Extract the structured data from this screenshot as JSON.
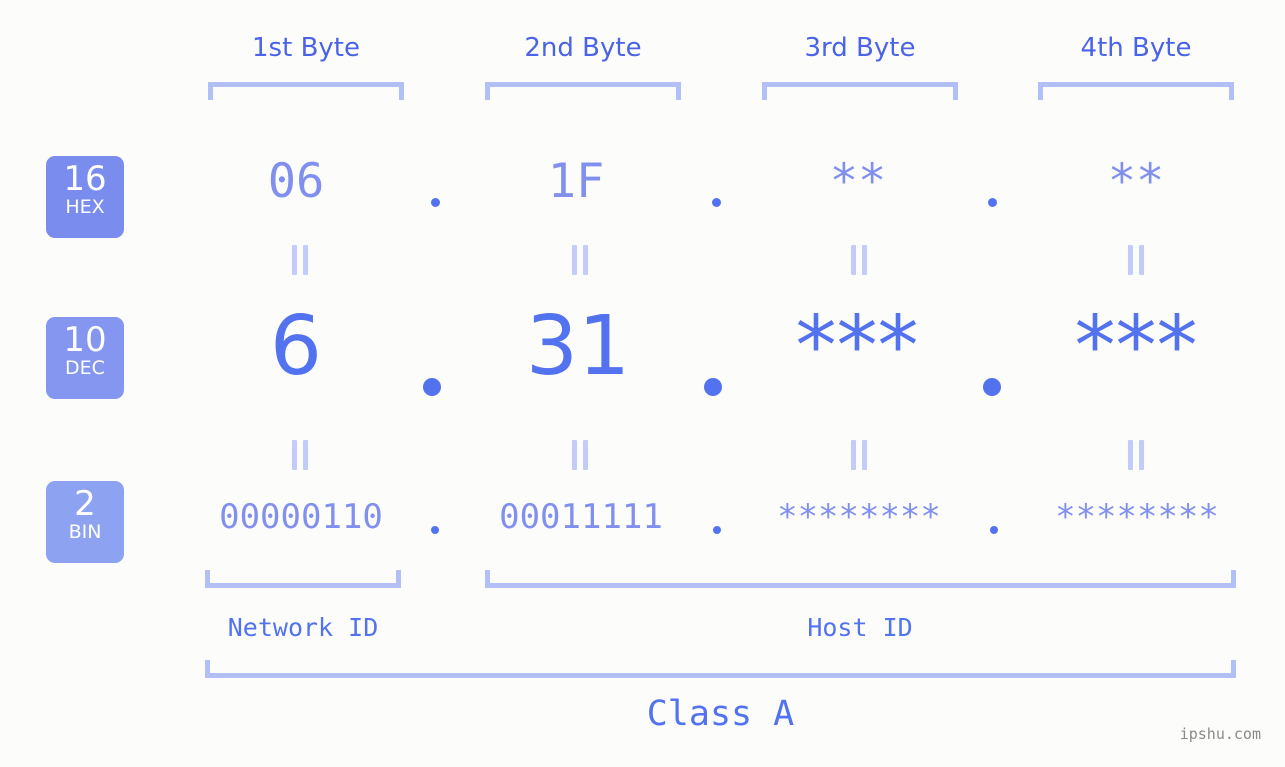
{
  "background_color": "#fcfdfa",
  "accent_colors": {
    "strong_blue": "#5272ef",
    "mid_blue": "#8190ee",
    "light_blue": "#b3bff7",
    "pale_blue": "#c3ccf8",
    "badge_hex": "#7a8ced",
    "badge_dec": "#8496ef",
    "badge_bin": "#8da3f2",
    "watermark_gray": "#8a8a8a"
  },
  "header": {
    "byte_labels": [
      "1st Byte",
      "2nd Byte",
      "3rd Byte",
      "4th Byte"
    ]
  },
  "radix_badges": [
    {
      "number": "16",
      "name": "HEX"
    },
    {
      "number": "10",
      "name": "DEC"
    },
    {
      "number": "2",
      "name": "BIN"
    }
  ],
  "rows": {
    "hex": {
      "radix_number": "16",
      "radix_name": "HEX",
      "values": [
        "06",
        "1F",
        "**",
        "**"
      ],
      "separator": "."
    },
    "dec": {
      "radix_number": "10",
      "radix_name": "DEC",
      "values": [
        "6",
        "31",
        "***",
        "***"
      ],
      "separator": "."
    },
    "bin": {
      "radix_number": "2",
      "radix_name": "BIN",
      "values": [
        "00000110",
        "00011111",
        "********",
        "********"
      ],
      "separator": "."
    }
  },
  "equality_marks": {
    "glyph": "||",
    "count_per_row": 4,
    "rows": 2
  },
  "footer": {
    "network_id_label": "Network ID",
    "host_id_label": "Host ID",
    "class_label": "Class A"
  },
  "watermark": {
    "text": "ipshu.com"
  }
}
